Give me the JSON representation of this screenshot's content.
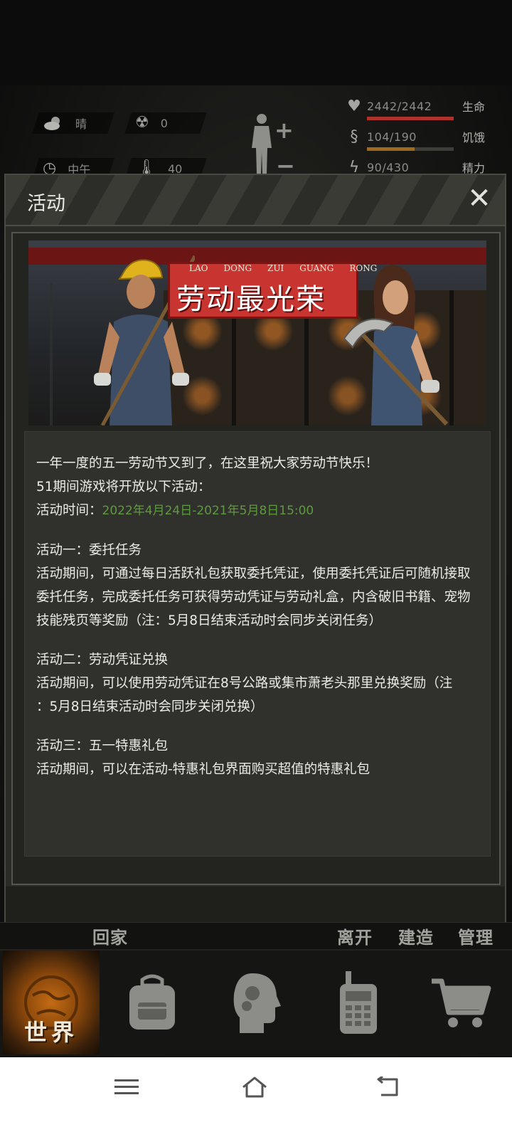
{
  "hud": {
    "weather": "晴",
    "radiation": "0",
    "time_of_day": "中午",
    "temperature": "40",
    "health": {
      "value": "2442/2442",
      "label": "生命",
      "fraction": 1.0,
      "color": "#b0322c"
    },
    "hunger": {
      "value": "104/190",
      "label": "饥饿",
      "fraction": 0.547,
      "color": "#a06a1e"
    },
    "energy": {
      "value": "90/430",
      "label": "精力",
      "fraction": 0.209,
      "color": "#3f6f9a"
    }
  },
  "modal": {
    "title": "活动",
    "close_glyph": "✕",
    "banner": {
      "pinyin": [
        "LAO",
        "DONG",
        "ZUI",
        "GUANG",
        "RONG"
      ],
      "title": "劳动最光荣"
    },
    "content": {
      "intro": "一年一度的五一劳动节又到了，在这里祝大家劳动节快乐！",
      "intro2": "51期间游戏将开放以下活动：",
      "time_label": "活动时间：",
      "time_value": "2022年4月24日-2021年5月8日15:00",
      "a1_title": "活动一：委托任务",
      "a1_l1": "活动期间，可通过每日活跃礼包获取委托凭证，使用委托凭证后可随机接取",
      "a1_l2": "委托任务，完成委托任务可获得劳动凭证与劳动礼盒，内含破旧书籍、宠物",
      "a1_l3": "技能残页等奖励（注：5月8日结束活动时会同步关闭任务）",
      "a2_title": "活动二：劳动凭证兑换",
      "a2_l1": "活动期间，可以使用劳动凭证在8号公路或集市萧老头那里兑换奖励（注",
      "a2_l2": "：5月8日结束活动时会同步关闭兑换）",
      "a3_title": "活动三：五一特惠礼包",
      "a3_l1": "活动期间，可以在活动-特惠礼包界面购买超值的特惠礼包"
    }
  },
  "actions": {
    "home": "回家",
    "leave": "离开",
    "build": "建造",
    "manage": "管理"
  },
  "nav": {
    "world": "世界"
  },
  "colors": {
    "accent_green": "#5e9a3e",
    "world_orange": "#c26b14"
  }
}
